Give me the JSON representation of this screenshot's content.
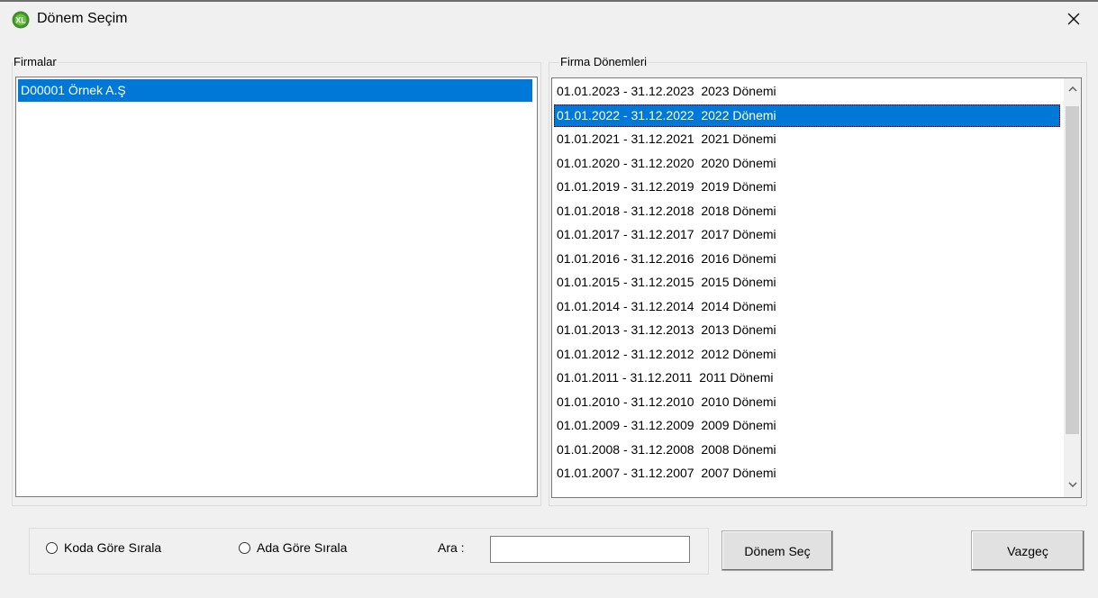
{
  "window": {
    "title": "Dönem Seçim",
    "app_icon": "xl-logo-icon"
  },
  "firmalar": {
    "label": "Firmalar",
    "items": [
      "D00001 Örnek A.Ş"
    ],
    "selected_index": 0
  },
  "donemler": {
    "label": "Firma Dönemleri",
    "items": [
      "01.01.2023 - 31.12.2023  2023 Dönemi",
      "01.01.2022 - 31.12.2022  2022 Dönemi",
      "01.01.2021 - 31.12.2021  2021 Dönemi",
      "01.01.2020 - 31.12.2020  2020 Dönemi",
      "01.01.2019 - 31.12.2019  2019 Dönemi",
      "01.01.2018 - 31.12.2018  2018 Dönemi",
      "01.01.2017 - 31.12.2017  2017 Dönemi",
      "01.01.2016 - 31.12.2016  2016 Dönemi",
      "01.01.2015 - 31.12.2015  2015 Dönemi",
      "01.01.2014 - 31.12.2014  2014 Dönemi",
      "01.01.2013 - 31.12.2013  2013 Dönemi",
      "01.01.2012 - 31.12.2012  2012 Dönemi",
      "01.01.2011 - 31.12.2011  2011 Dönemi",
      "01.01.2010 - 31.12.2010  2010 Dönemi",
      "01.01.2009 - 31.12.2009  2009 Dönemi",
      "01.01.2008 - 31.12.2008  2008 Dönemi",
      "01.01.2007 - 31.12.2007  2007 Dönemi"
    ],
    "selected_index": 1
  },
  "sort": {
    "by_code": "Koda Göre Sırala",
    "by_name": "Ada Göre Sırala"
  },
  "search": {
    "label": "Ara :",
    "value": ""
  },
  "buttons": {
    "select": "Dönem Seç",
    "cancel": "Vazgeç"
  },
  "colors": {
    "selection": "#0078d7",
    "background": "#f0f0f0",
    "icon_green": "#3f8f2f"
  }
}
